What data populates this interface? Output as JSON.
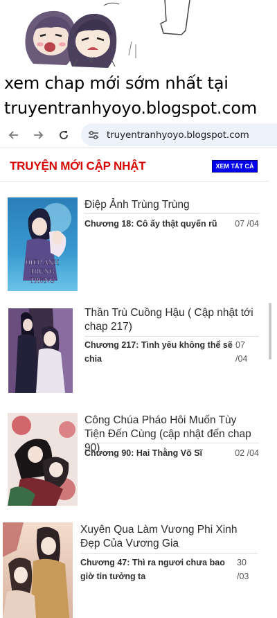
{
  "promo": {
    "line1": "xem chap mới sớm nhất tại",
    "line2": "truyentranhyoyo.blogspot.com"
  },
  "browser": {
    "url": "truyentranhyoyo.blogspot.com",
    "back_icon": "arrow-left-icon",
    "forward_icon": "arrow-right-icon",
    "reload_icon": "reload-icon",
    "site_info_icon": "tune-icon"
  },
  "section": {
    "title": "TRUYỆN MỚI CẬP NHẬT",
    "see_all": "XEM TẤT CẢ",
    "title_color": "#d80000",
    "button_color": "#0000ee"
  },
  "comics": [
    {
      "title": "Điệp Ảnh Trùng Trùng",
      "chapter": "Chương 18: Cô ấy thật quyến rũ",
      "date": "07 /04",
      "cover_text": "ĐIỆP ẢNH TRÙNG TRÙNG"
    },
    {
      "title": "Thần Trù Cuồng Hậu ( Cập nhật tới chap 217)",
      "chapter": "Chương 217: Tình yêu không thể sẽ chia",
      "date": "07 /04"
    },
    {
      "title": "Công Chúa Pháo Hôi Muốn Tùy Tiện Đến Cùng (cập nhật đến chap 90)",
      "chapter": "Chương 90: Hai Thằng Võ Sĩ",
      "date": "02 /04"
    },
    {
      "title": "Xuyên Qua Làm Vương Phi Xinh Đẹp Của Vương Gia",
      "chapter": "Chương 47: Thì ra ngươi chưa bao giờ tin tưởng ta",
      "date": "30 /03"
    }
  ]
}
